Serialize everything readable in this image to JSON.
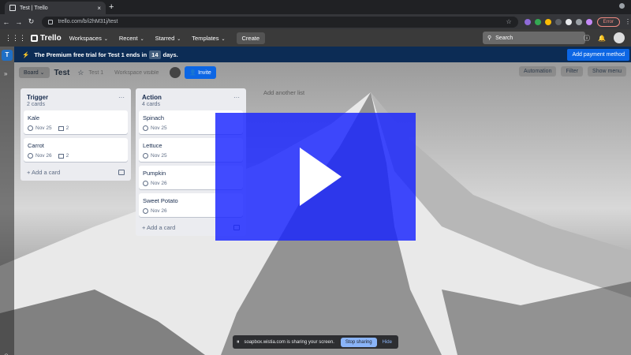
{
  "browser": {
    "tab_title": "Test | Trello",
    "tab_close": "×",
    "new_tab": "+",
    "back": "←",
    "forward": "→",
    "reload": "↻",
    "url": "trello.com/b/i2hM31j/test",
    "bookmark_icon": "☆",
    "error_label": "Error",
    "menu_icon": "⋮"
  },
  "trello": {
    "apps_icon": "⋮⋮⋮",
    "logo_text": "Trello",
    "nav": [
      {
        "label": "Workspaces"
      },
      {
        "label": "Recent"
      },
      {
        "label": "Starred"
      },
      {
        "label": "Templates"
      }
    ],
    "nav_chevron": "⌄",
    "create_label": "Create",
    "search_placeholder": "Search",
    "search_icon": "⚲",
    "info_icon": "ⓘ",
    "bell_icon": "🔔"
  },
  "sidebar": {
    "workspace_letter": "T",
    "expand_icon": "»",
    "help_icon": "⊙"
  },
  "banner": {
    "icon": "⚡",
    "text_before": "The Premium free trial for Test 1 ends in",
    "days": "14",
    "text_after": "days.",
    "cta_label": "Add payment method"
  },
  "board": {
    "view_label": "Board",
    "view_chevron": "⌄",
    "title": "Test",
    "star_icon": "☆",
    "faded_items": [
      "Test 1",
      "Workspace visible"
    ],
    "invite_label": "Invite",
    "invite_icon": "👤",
    "right_buttons": [
      {
        "label": "Automation"
      },
      {
        "label": "Filter"
      },
      {
        "label": "Show menu"
      }
    ],
    "add_list_label": "Add another list"
  },
  "lists": [
    {
      "title": "Trigger",
      "count": "2 cards",
      "menu": "···",
      "add_card": "+ Add a card",
      "cards": [
        {
          "title": "Kale",
          "date": "Nov 25",
          "attachments": "2"
        },
        {
          "title": "Carrot",
          "date": "Nov 26",
          "attachments": "2"
        }
      ]
    },
    {
      "title": "Action",
      "count": "4 cards",
      "menu": "···",
      "add_card": "+ Add a card",
      "cards": [
        {
          "title": "Spinach",
          "date": "Nov 25"
        },
        {
          "title": "Lettuce",
          "date": "Nov 25"
        },
        {
          "title": "Pumpkin",
          "date": "Nov 26"
        },
        {
          "title": "Sweet Potato",
          "date": "Nov 26"
        }
      ]
    }
  ],
  "screen_share": {
    "pause_icon": "⏸",
    "message": "soapbox.wistia.com is sharing your screen.",
    "stop_label": "Stop sharing",
    "hide_label": "Hide"
  },
  "colors": {
    "play_overlay": "#1723ff",
    "banner": "#0c2c55",
    "primary_button": "#0c66e4",
    "workspace_badge": "#1f6fc5"
  }
}
